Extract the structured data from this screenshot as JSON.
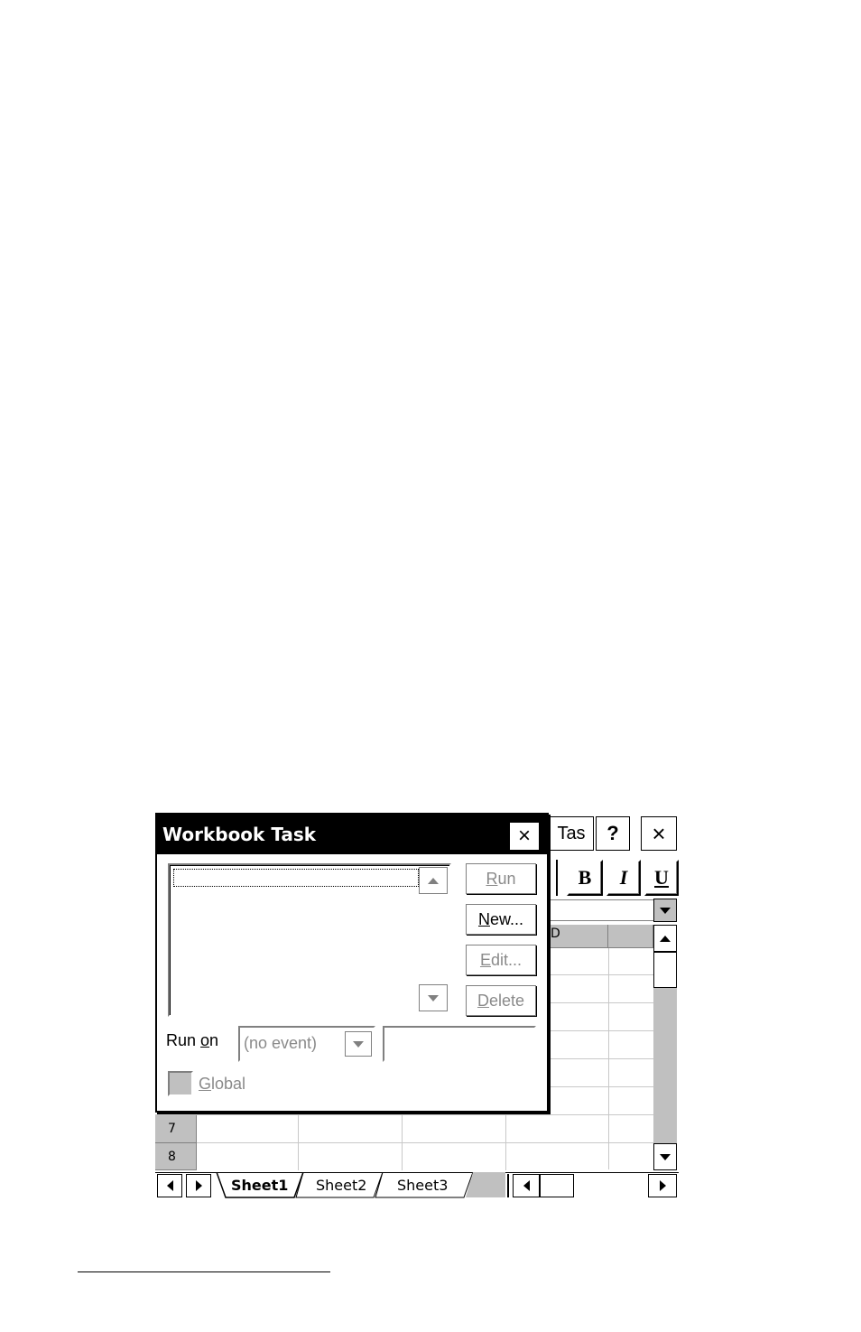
{
  "app": {
    "toolbar": {
      "task_label_visible": "Tas",
      "help_label": "?",
      "close_label": "×",
      "bold_label": "B",
      "italic_label": "I",
      "underline_label": "U"
    },
    "grid": {
      "column_headers": [
        "D"
      ],
      "row_headers": [
        "7",
        "8"
      ]
    },
    "sheet_tabs": [
      {
        "label": "Sheet1",
        "active": true
      },
      {
        "label": "Sheet2",
        "active": false
      },
      {
        "label": "Sheet3",
        "active": false
      }
    ]
  },
  "dialog": {
    "title": "Workbook Task",
    "close_label": "×",
    "buttons": {
      "run": {
        "pre": "",
        "key": "R",
        "post": "un",
        "enabled": false
      },
      "new": {
        "pre": "",
        "key": "N",
        "post": "ew...",
        "enabled": true
      },
      "edit": {
        "pre": "",
        "key": "E",
        "post": "dit...",
        "enabled": false
      },
      "delete": {
        "pre": "",
        "key": "D",
        "post": "elete",
        "enabled": false
      }
    },
    "run_on": {
      "label_pre": "Run ",
      "label_key": "o",
      "label_post": "n",
      "selected": "(no event)",
      "value": ""
    },
    "global": {
      "key": "G",
      "post": "lobal",
      "checked": false,
      "enabled": false
    }
  },
  "colors": {
    "title_bar": "#000000",
    "chrome_gray": "#c0c0c0",
    "disabled_text": "#8a8a8a"
  }
}
